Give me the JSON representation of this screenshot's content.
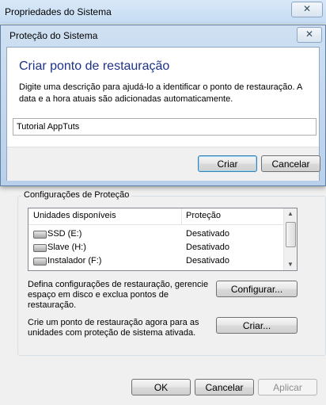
{
  "outer": {
    "title": "Propriedades do Sistema",
    "close_glyph": "✕",
    "group_label": "Configurações de Proteção",
    "list_headers": [
      "Unidades disponíveis",
      "Proteção"
    ],
    "drives": [
      {
        "name": "SSD (E:)",
        "protection": "Desativado"
      },
      {
        "name": "Slave (H:)",
        "protection": "Desativado"
      },
      {
        "name": "Instalador (F:)",
        "protection": "Desativado"
      }
    ],
    "configure_text": "Defina configurações de restauração, gerencie espaço em disco e exclua pontos de restauração.",
    "configure_button": "Configurar...",
    "create_text": "Crie um ponto de restauração agora para as unidades com proteção de sistema ativada.",
    "create_button": "Criar...",
    "ok_button": "OK",
    "cancel_button": "Cancelar",
    "apply_button": "Aplicar"
  },
  "dialog": {
    "title": "Proteção do Sistema",
    "close_glyph": "✕",
    "heading": "Criar ponto de restauração",
    "description": "Digite uma descrição para ajudá-lo a identificar o ponto de restauração. A data e a hora atuais são adicionadas automaticamente.",
    "input_value": "Tutorial AppTuts",
    "create_button": "Criar",
    "cancel_button": "Cancelar"
  }
}
